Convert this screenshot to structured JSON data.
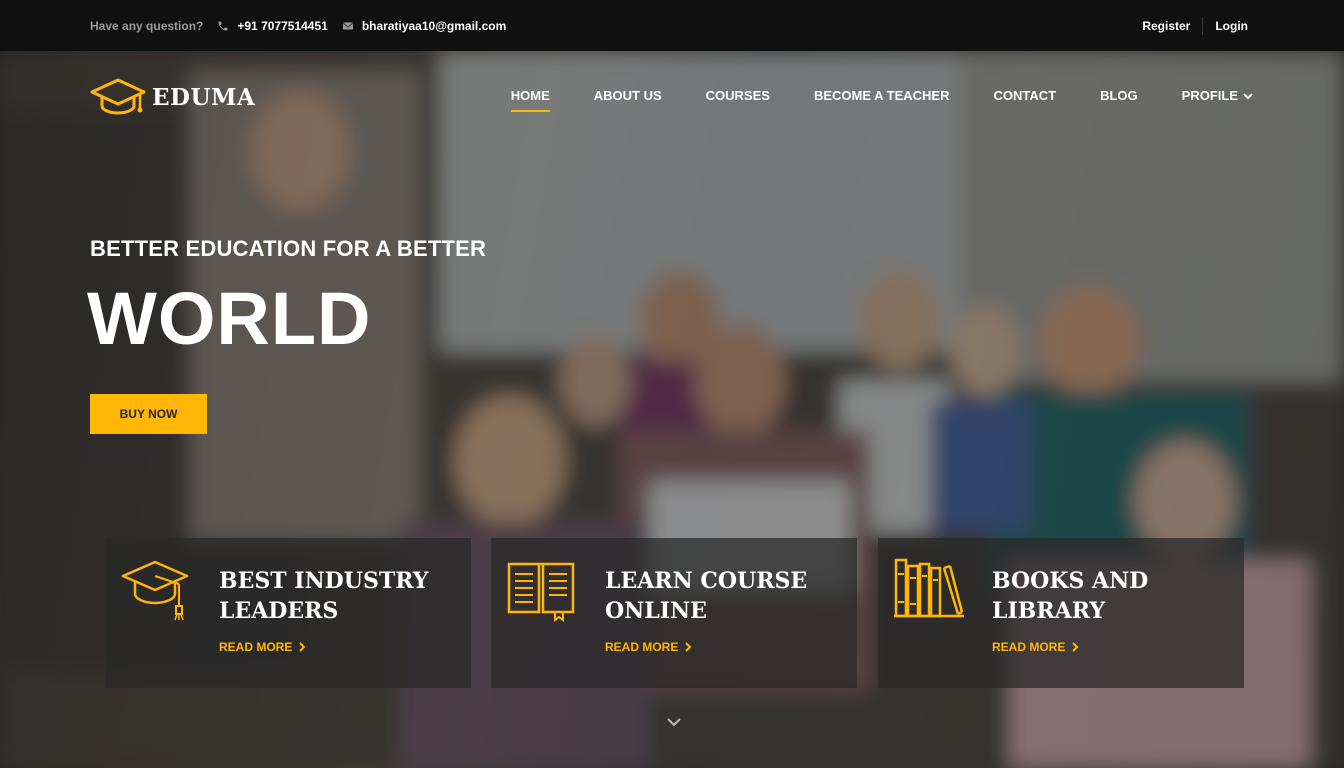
{
  "topbar": {
    "question": "Have any question?",
    "phone": "+91 7077514451",
    "email": "bharatiyaa10@gmail.com",
    "register": "Register",
    "login": "Login"
  },
  "logo": {
    "text": "EDUMA",
    "icon": "graduation-cap-icon"
  },
  "nav": {
    "items": [
      "HOME",
      "ABOUT US",
      "COURSES",
      "BECOME A TEACHER",
      "CONTACT",
      "BLOG",
      "PROFILE"
    ],
    "active": "HOME"
  },
  "hero": {
    "tagline": "BETTER EDUCATION FOR A BETTER",
    "headline": "WORLD",
    "button": "BUY NOW"
  },
  "features": [
    {
      "title": "BEST INDUSTRY LEADERS",
      "link": "READ MORE",
      "icon": "graduation-cap-icon"
    },
    {
      "title": "LEARN COURSE ONLINE",
      "link": "READ MORE",
      "icon": "open-book-icon"
    },
    {
      "title": "BOOKS AND LIBRARY",
      "link": "READ MORE",
      "icon": "books-icon"
    }
  ],
  "colors": {
    "accent": "#ffb606",
    "topbar": "#111111"
  }
}
